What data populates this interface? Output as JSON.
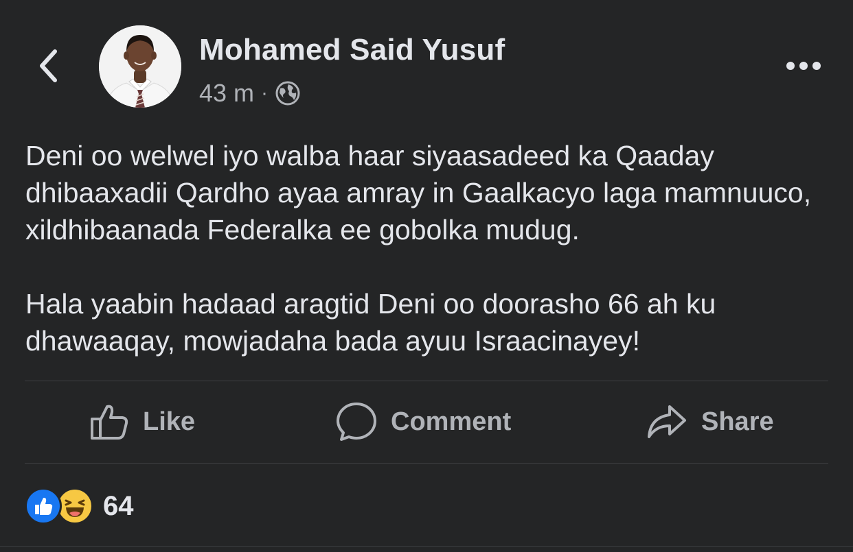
{
  "header": {
    "author_name": "Mohamed Said Yusuf",
    "timestamp": "43 m",
    "separator": "·",
    "privacy_icon": "globe-icon",
    "back_icon": "chevron-left-icon",
    "more_icon": "more-horizontal-icon",
    "avatar_alt": "profile photo"
  },
  "post": {
    "paragraphs": [
      "Deni oo welwel iyo walba haar siyaasadeed ka Qaaday dhibaaxadii Qardho ayaa amray in Gaalkacyo laga mamnuuco, xildhibaanada Federalka ee gobolka mudug.",
      "Hala yaabin hadaad aragtid Deni oo doorasho 66 ah ku dhawaaqay, mowjadaha bada ayuu Israacinayey!"
    ]
  },
  "actions": {
    "like_label": "Like",
    "comment_label": "Comment",
    "share_label": "Share"
  },
  "reactions": {
    "types": [
      "like",
      "haha"
    ],
    "count": "64"
  },
  "colors": {
    "background": "#242526",
    "text_primary": "#e4e6eb",
    "text_secondary": "#b0b3b8",
    "divider": "#3e4042",
    "like_blue": "#1877f2",
    "haha_yellow": "#f7c843"
  }
}
